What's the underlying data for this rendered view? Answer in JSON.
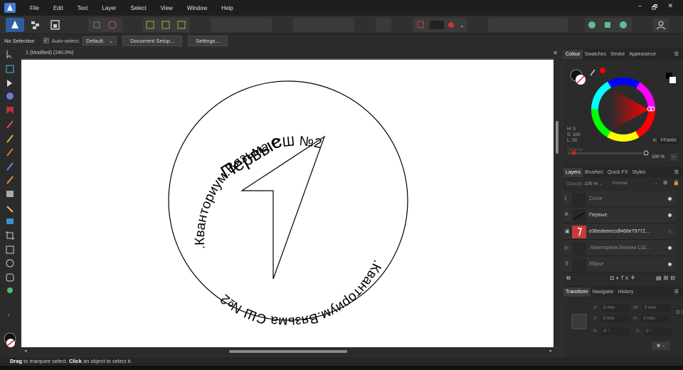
{
  "menubar": {
    "items": [
      "File",
      "Edit",
      "Text",
      "Layer",
      "Select",
      "View",
      "Window",
      "Help"
    ],
    "window_controls": [
      "–",
      "🗗",
      "✕"
    ]
  },
  "context": {
    "selection": "No Selection",
    "auto_select_label": "Auto-select:",
    "auto_select_value": "Default",
    "document_setup": "Document Setup...",
    "settings": "Settings..."
  },
  "document": {
    "tab_title": "1 (Modified) (240.0%)",
    "texts": {
      "top_arc": ".Кванториум.Вязьма СШ №2",
      "bottom_arc": ".Кванториум.Вязьма СШ №2",
      "center": "Первые"
    }
  },
  "colour_panel": {
    "tabs": [
      "Colour",
      "Swatches",
      "Stroke",
      "Appearance"
    ],
    "h": "H: 0",
    "s": "S: 100",
    "l": "L: 50",
    "hex_label": "#:",
    "hex": "FF0000",
    "opacity_label": "Opacity",
    "opacity_value": "100 %"
  },
  "layers_panel": {
    "tabs": [
      "Layers",
      "Brushes",
      "Quick FX",
      "Styles"
    ],
    "opacity_label": "Opacity:",
    "opacity_value": "100 %",
    "blend_mode": "Normal",
    "layers": [
      {
        "icon": "(",
        "name": "Curve"
      },
      {
        "icon": "A",
        "name": "Первые"
      },
      {
        "icon": "▣",
        "name": "e36edeeeccdf466e79772..."
      },
      {
        "icon": "▷",
        "name": ".Кванториум.Вязьма СШ..."
      },
      {
        "icon": "⠿",
        "name": "Ellipse"
      }
    ]
  },
  "transform_panel": {
    "tabs": [
      "Transform",
      "Navigator",
      "History"
    ],
    "x": "0 mm",
    "y": "0 mm",
    "w": "0 mm",
    "h": "0 mm",
    "r": "0 °",
    "s": "0 °"
  },
  "status": {
    "drag": "Drag",
    "drag_text": " to marquee select. ",
    "click": "Click",
    "click_text": " an object to select it."
  },
  "colors": {
    "accent": "#3d7dd8",
    "selected_colour": "#ff0000"
  }
}
